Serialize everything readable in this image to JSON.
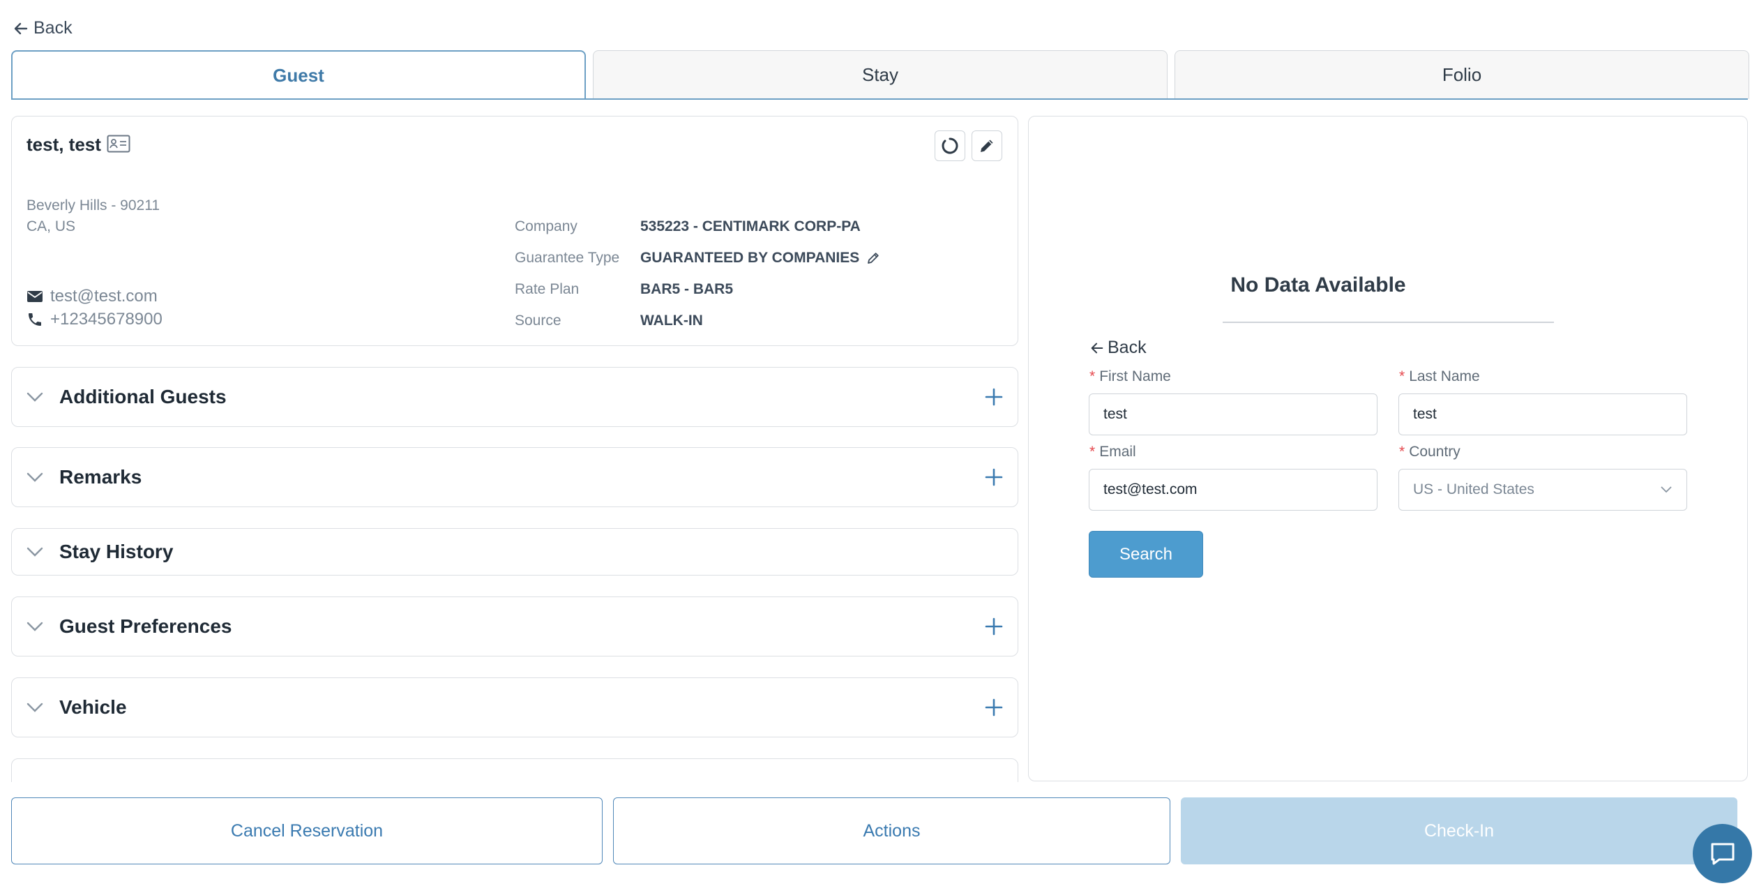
{
  "nav": {
    "back_label": "Back"
  },
  "tabs": [
    {
      "label": "Guest",
      "active": true
    },
    {
      "label": "Stay",
      "active": false
    },
    {
      "label": "Folio",
      "active": false
    }
  ],
  "guest": {
    "name": "test, test",
    "address_line1": "Beverly Hills  - 90211",
    "address_line2": "CA, US",
    "email": "test@test.com",
    "phone": "+12345678900",
    "details": [
      {
        "label": "Company",
        "value": "535223 - CENTIMARK CORP-PA"
      },
      {
        "label": "Guarantee Type",
        "value": "GUARANTEED BY COMPANIES"
      },
      {
        "label": "Rate Plan",
        "value": "BAR5 - BAR5"
      },
      {
        "label": "Source",
        "value": "WALK-IN"
      }
    ]
  },
  "sections": [
    {
      "title": "Additional Guests",
      "has_add": true
    },
    {
      "title": "Remarks",
      "has_add": true
    },
    {
      "title": "Stay History",
      "has_add": false
    },
    {
      "title": "Guest Preferences",
      "has_add": true
    },
    {
      "title": "Vehicle",
      "has_add": true
    }
  ],
  "search_panel": {
    "empty_text": "No Data Available",
    "back_label": "Back",
    "first_name_label": "First Name",
    "first_name_value": "test",
    "last_name_label": "Last Name",
    "last_name_value": "test",
    "email_label": "Email",
    "email_value": "test@test.com",
    "country_label": "Country",
    "country_value": "US - United States",
    "search_label": "Search"
  },
  "footer": {
    "cancel_label": "Cancel Reservation",
    "actions_label": "Actions",
    "checkin_label": "Check-In"
  },
  "colors": {
    "accent": "#3f7aa8",
    "primary_button": "#4d9ccf",
    "disabled_button": "#b9d6ea",
    "required": "#e5484d",
    "chat": "#3578a8"
  }
}
